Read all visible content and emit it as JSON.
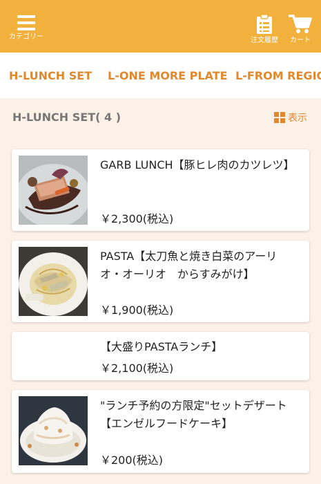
{
  "header": {
    "menu_label": "カテゴリー",
    "history_label": "注文履歴",
    "cart_label": "カート"
  },
  "tabs": [
    {
      "label": "H-LUNCH SET"
    },
    {
      "label": "L-ONE MORE PLATE"
    },
    {
      "label": "L-FROM REGION"
    }
  ],
  "section": {
    "title": "H-LUNCH SET( 4 )",
    "view_label": "表示"
  },
  "items": [
    {
      "name": "GARB LUNCH【豚ヒレ肉のカツレツ】",
      "price": "￥2,300(税込)"
    },
    {
      "name": "PASTA【太刀魚と焼き白菜のアーリオ・オーリオ　からすみがけ】",
      "price": "￥1,900(税込)"
    },
    {
      "name": "【大盛りPASTAランチ】",
      "price": "￥2,100(税込)"
    },
    {
      "name": "\"ランチ予約の方限定\"セットデザート【エンゼルフードケーキ】",
      "price": "￥200(税込)"
    }
  ],
  "colors": {
    "header": "#f2b03c",
    "accent": "#e0882e",
    "background": "#fbf1e6"
  }
}
